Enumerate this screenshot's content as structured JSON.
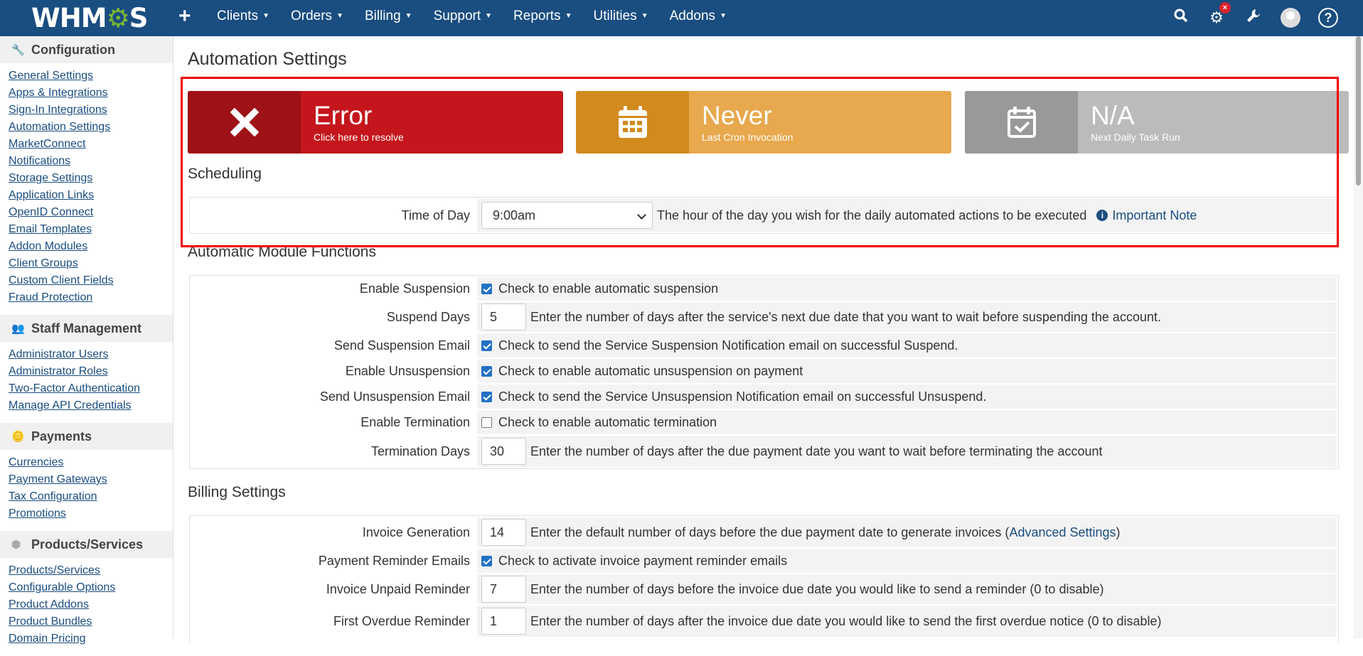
{
  "topbar": {
    "logo": "WHMCS",
    "nav": [
      "Clients",
      "Orders",
      "Billing",
      "Support",
      "Reports",
      "Utilities",
      "Addons"
    ],
    "icons": [
      "search-icon",
      "gear-icon",
      "wrench-icon",
      "avatar",
      "help-icon"
    ],
    "notification_badge": "×"
  },
  "sidebar": {
    "sections": [
      {
        "title": "Configuration",
        "icon": "wrench-icon",
        "links": [
          "General Settings",
          "Apps & Integrations",
          "Sign-In Integrations",
          "Automation Settings",
          "MarketConnect",
          "Notifications",
          "Storage Settings",
          "Application Links",
          "OpenID Connect",
          "Email Templates",
          "Addon Modules",
          "Client Groups",
          "Custom Client Fields",
          "Fraud Protection"
        ]
      },
      {
        "title": "Staff Management",
        "icon": "users-icon",
        "links": [
          "Administrator Users",
          "Administrator Roles",
          "Two-Factor Authentication",
          "Manage API Credentials"
        ]
      },
      {
        "title": "Payments",
        "icon": "coins-icon",
        "links": [
          "Currencies",
          "Payment Gateways",
          "Tax Configuration",
          "Promotions"
        ]
      },
      {
        "title": "Products/Services",
        "icon": "cubes-icon",
        "links": [
          "Products/Services",
          "Configurable Options",
          "Product Addons",
          "Product Bundles",
          "Domain Pricing"
        ]
      }
    ]
  },
  "main": {
    "title": "Automation Settings",
    "tiles": [
      {
        "big": "Error",
        "sub": "Click here to resolve",
        "icon": "close-icon",
        "color": "#c4161c"
      },
      {
        "big": "Never",
        "sub": "Last Cron Invocation",
        "icon": "calendar-icon",
        "color": "#e8a84d"
      },
      {
        "big": "N/A",
        "sub": "Next Daily Task Run",
        "icon": "calendar-check-icon",
        "color": "#bbbbbb"
      }
    ],
    "scheduling": {
      "title": "Scheduling",
      "label": "Time of Day",
      "value": "9:00am",
      "desc": "The hour of the day you wish for the daily automated actions to be executed",
      "note": "Important Note"
    },
    "module": {
      "title": "Automatic Module Functions",
      "enable_suspension": {
        "label": "Enable Suspension",
        "checked": true,
        "desc": "Check to enable automatic suspension"
      },
      "suspend_days": {
        "label": "Suspend Days",
        "value": "5",
        "desc": "Enter the number of days after the service's next due date that you want to wait before suspending the account."
      },
      "send_suspension": {
        "label": "Send Suspension Email",
        "checked": true,
        "desc": "Check to send the Service Suspension Notification email on successful Suspend."
      },
      "enable_unsuspension": {
        "label": "Enable Unsuspension",
        "checked": true,
        "desc": "Check to enable automatic unsuspension on payment"
      },
      "send_unsuspension": {
        "label": "Send Unsuspension Email",
        "checked": true,
        "desc": "Check to send the Service Unsuspension Notification email on successful Unsuspend."
      },
      "enable_termination": {
        "label": "Enable Termination",
        "checked": false,
        "desc": "Check to enable automatic termination"
      },
      "termination_days": {
        "label": "Termination Days",
        "value": "30",
        "desc": "Enter the number of days after the due payment date you want to wait before terminating the account"
      }
    },
    "billing": {
      "title": "Billing Settings",
      "invoice_generation": {
        "label": "Invoice Generation",
        "value": "14",
        "desc": "Enter the default number of days before the due payment date to generate invoices (",
        "link": "Advanced Settings",
        "after": ")"
      },
      "payment_reminder": {
        "label": "Payment Reminder Emails",
        "checked": true,
        "desc": "Check to activate invoice payment reminder emails"
      },
      "unpaid_reminder": {
        "label": "Invoice Unpaid Reminder",
        "value": "7",
        "desc": "Enter the number of days before the invoice due date you would like to send a reminder (0 to disable)"
      },
      "first_overdue": {
        "label": "First Overdue Reminder",
        "value": "1",
        "desc": "Enter the number of days after the invoice due date you would like to send the first overdue notice (0 to disable)"
      }
    }
  }
}
